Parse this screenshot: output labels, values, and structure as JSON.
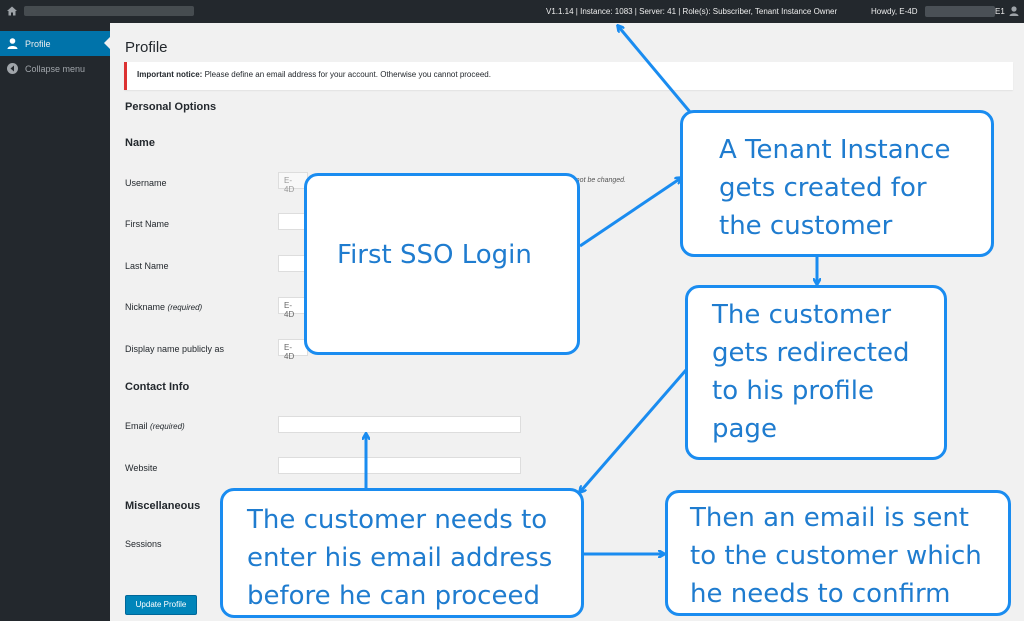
{
  "adminbar": {
    "info": "V1.1.14 | Instance: 1083 | Server: 41 | Role(s): Subscriber, Tenant Instance Owner",
    "howdy": "Howdy, E-4D",
    "user_suffix": "E1"
  },
  "sidebar": {
    "items": [
      {
        "label": "Profile"
      },
      {
        "label": "Collapse menu"
      }
    ]
  },
  "main": {
    "title": "Profile",
    "notice_strong": "Important notice:",
    "notice_text": " Please define an email address for your account. Otherwise you cannot proceed.",
    "sections": {
      "personal": "Personal Options",
      "name": "Name",
      "contact": "Contact Info",
      "misc": "Miscellaneous"
    },
    "fields": {
      "username": "Username",
      "username_value": "E-4D",
      "username_note": "annot be changed.",
      "first_name": "First Name",
      "last_name": "Last Name",
      "nickname": "Nickname",
      "nickname_req": "(required)",
      "nickname_value": "E-4D",
      "display_name": "Display name publicly as",
      "display_value": "E-4D",
      "email": "Email",
      "email_req": "(required)",
      "website": "Website",
      "sessions": "Sessions"
    },
    "update_button": "Update Profile"
  },
  "callouts": {
    "first_sso": "First SSO Login",
    "tenant": [
      "A Tenant Instance",
      "gets created for",
      "the customer"
    ],
    "redirect": [
      "The customer",
      "gets redirected",
      "to his profile",
      "page"
    ],
    "email_needed": [
      "The customer needs to",
      "enter his email address",
      "before he can proceed"
    ],
    "email_sent": [
      "Then an email is sent",
      "to the customer which",
      "he needs to confirm"
    ]
  },
  "colors": {
    "accent": "#0073aa",
    "callout_border": "#1a8cf0",
    "callout_text": "#1f7ccf",
    "notice_border": "#dc3232"
  }
}
